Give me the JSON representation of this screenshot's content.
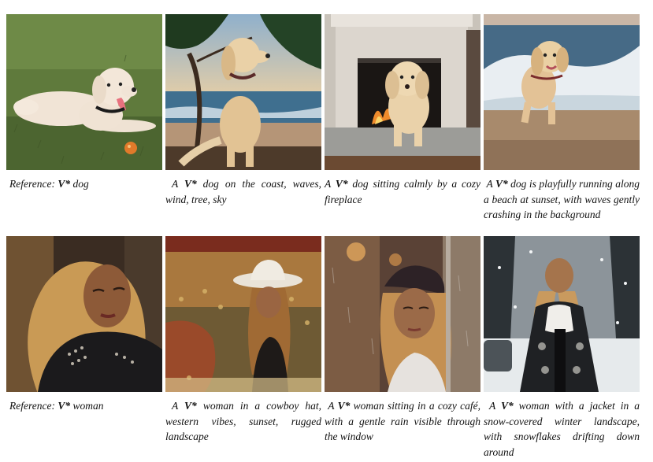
{
  "figure": {
    "rows": [
      {
        "name": "dog",
        "cells": [
          {
            "image": "reference-dog-on-grass",
            "caption_prefix": "Reference: ",
            "token": "V*",
            "caption_rest": " dog"
          },
          {
            "image": "dog-on-coast-with-tree",
            "caption_prefix": "A ",
            "token": "V*",
            "caption_rest": " dog on the coast, waves, wind, tree, sky"
          },
          {
            "image": "dog-by-fireplace",
            "caption_prefix": "A ",
            "token": "V*",
            "caption_rest": " dog sitting calmly by a cozy fireplace"
          },
          {
            "image": "dog-running-on-beach-sunset",
            "caption_prefix": "A ",
            "token": "V*",
            "caption_rest": " dog is playfully running along a beach at sunset, with waves gently crashing in the background"
          }
        ]
      },
      {
        "name": "woman",
        "cells": [
          {
            "image": "reference-woman-portrait",
            "caption_prefix": "Reference: ",
            "token": "V*",
            "caption_rest": " woman"
          },
          {
            "image": "woman-cowboy-hat-western",
            "caption_prefix": "A ",
            "token": "V*",
            "caption_rest": " woman in a cowboy hat, western vibes, sunset, rugged landscape"
          },
          {
            "image": "woman-in-cafe-rain-window",
            "caption_prefix": "A ",
            "token": "V*",
            "caption_rest": " woman sitting in a cozy café, with a gentle rain visible through the window"
          },
          {
            "image": "woman-jacket-winter-snow",
            "caption_prefix": "A ",
            "token": "V*",
            "caption_rest": " woman with a jacket in a snow-covered winter landscape, with snowflakes drifting down around"
          }
        ]
      }
    ]
  }
}
